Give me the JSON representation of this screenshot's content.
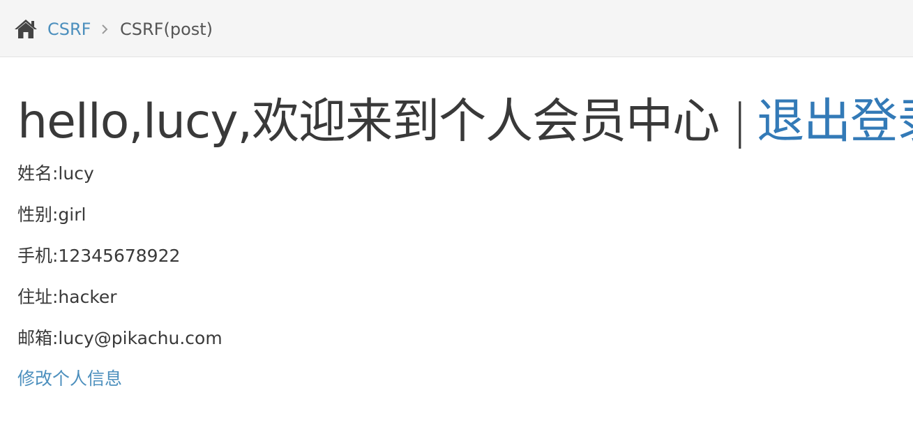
{
  "breadcrumb": {
    "home_icon": "home-icon",
    "link_label": "CSRF",
    "separator_icon": "chevron-right-icon",
    "current_label": "CSRF(post)"
  },
  "header": {
    "greeting": "hello,lucy,欢迎来到个人会员中心",
    "divider": "|",
    "logout_label": "退出登录"
  },
  "profile": {
    "name": "姓名:lucy",
    "sex": "性别:girl",
    "phone": "手机:12345678922",
    "address": "住址:hacker",
    "email": "邮箱:lucy@pikachu.com"
  },
  "edit_link_label": "修改个人信息",
  "colors": {
    "link": "#337ab7",
    "breadcrumb_link": "#4c8fbd",
    "text": "#393939",
    "breadcrumb_bg": "#f5f5f5"
  }
}
